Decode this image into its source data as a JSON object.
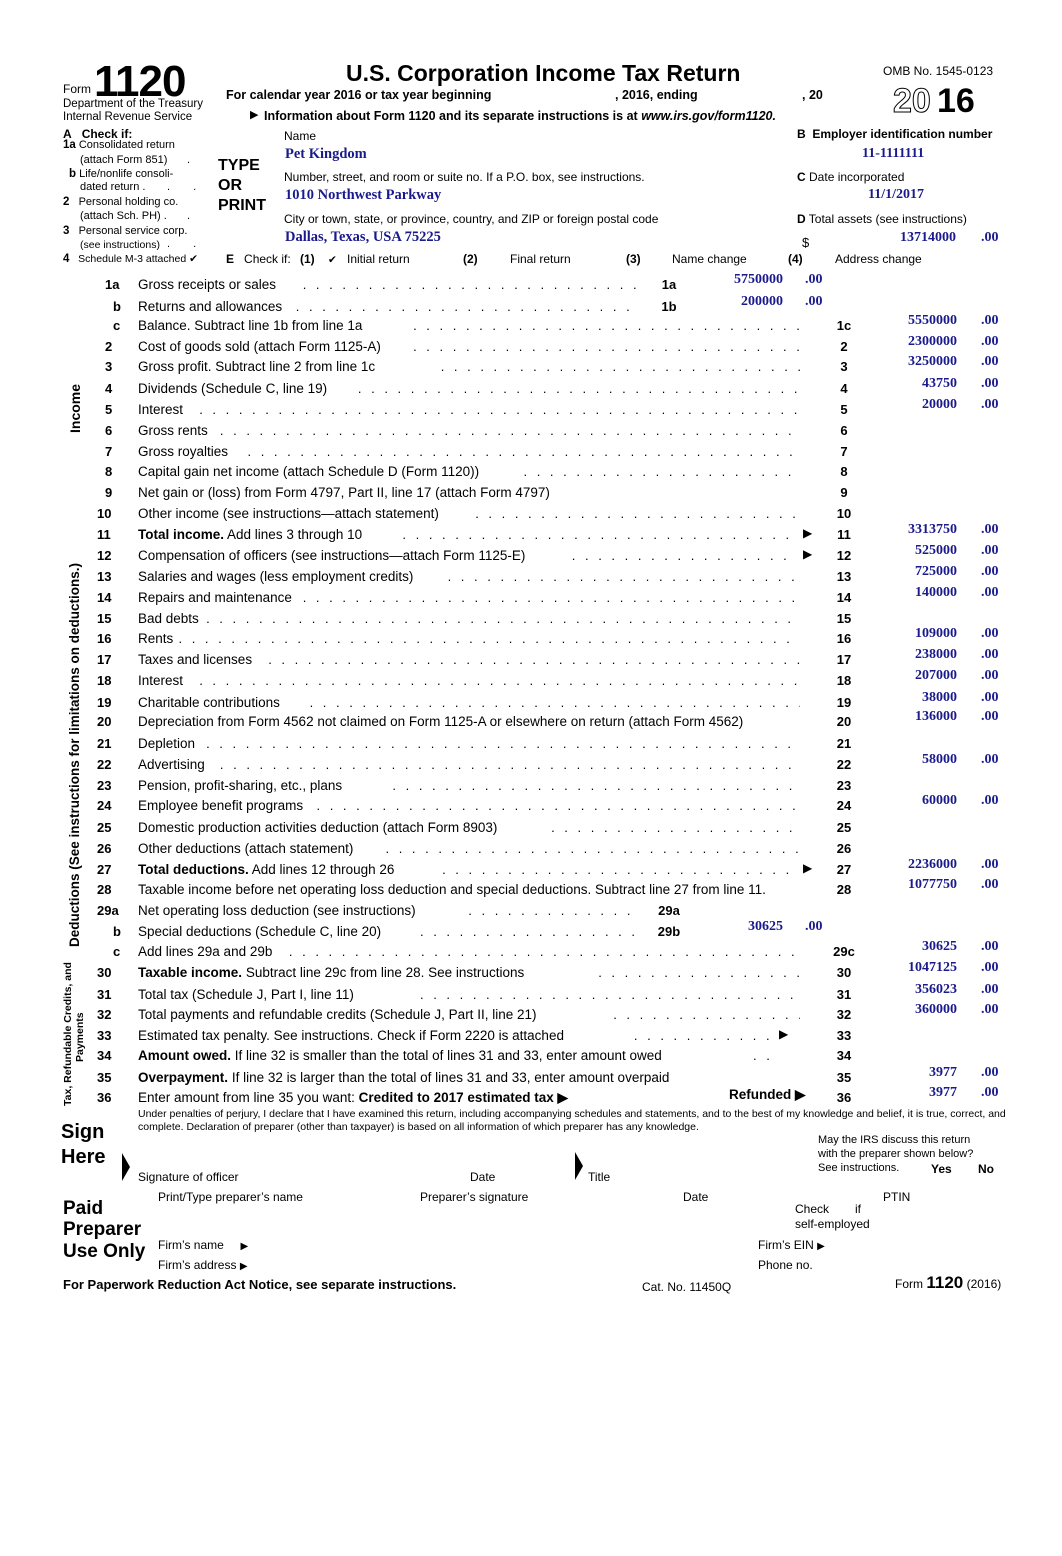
{
  "header": {
    "form_word": "Form",
    "form_number": "1120",
    "department": "Department of the Treasury",
    "agency": "Internal Revenue Service",
    "title": "U.S. Corporation Income Tax Return",
    "calendar_year_text": "For calendar year 2016 or tax year beginning",
    "calendar_year_mid": ", 2016, ending",
    "calendar_year_end": ", 20",
    "info_text": "Information about Form 1120 and its separate instructions is at",
    "info_url": "www.irs.gov/form1120.",
    "omb": "OMB No. 1545-0123",
    "year_outline": "20",
    "year_solid": "16"
  },
  "check_a": {
    "title_letter": "A",
    "title": "Check if:",
    "items": [
      {
        "num": "1a",
        "line1": "Consolidated return",
        "line2": "(attach Form 851)",
        "dots": ".",
        "check": ""
      },
      {
        "num": "b",
        "line1": "Life/nonlife consoli-",
        "line2": "dated return .",
        "dots": ". .",
        "check": ""
      },
      {
        "num": "2",
        "line1": "Personal holding co.",
        "line2": "(attach Sch. PH) .",
        "dots": ".",
        "check": ""
      },
      {
        "num": "3",
        "line1": "Personal service corp.",
        "line2": "(see instructions)",
        "dots": ". .",
        "check": ""
      },
      {
        "num": "4",
        "line1": "Schedule M-3 attached",
        "line2": "",
        "dots": "",
        "check": "✔"
      }
    ]
  },
  "type_or_print": "TYPE\nOR\nPRINT",
  "entity": {
    "name_label": "Name",
    "name": "Pet Kingdom",
    "street_label": "Number, street, and room or suite no. If a P.O. box, see instructions.",
    "street": "1010 Northwest Parkway",
    "city_label": "City or town, state, or province, country, and ZIP or foreign postal code",
    "city": "Dallas, Texas, USA 75225",
    "ein_letter": "B",
    "ein_label": "Employer identification number",
    "ein": "11-1111111",
    "inc_letter": "C",
    "inc_label": "Date incorporated",
    "inc_date": "11/1/2017",
    "assets_letter": "D",
    "assets_label": "Total assets (see instructions)",
    "assets_currency": "$",
    "assets": "13714000",
    "assets_cents": ".00"
  },
  "check_e": {
    "letter": "E",
    "label": "Check if:",
    "options": [
      {
        "num": "(1)",
        "label": "Initial return",
        "check": "✔"
      },
      {
        "num": "(2)",
        "label": "Final return",
        "check": ""
      },
      {
        "num": "(3)",
        "label": "Name change",
        "check": ""
      },
      {
        "num": "(4)",
        "label": "Address change",
        "check": ""
      }
    ]
  },
  "section_labels": {
    "income": "Income",
    "deductions": "Deductions (See instructions for limitations on deductions.)",
    "tax": "Tax, Refundable Credits, and",
    "tax2": "Payments"
  },
  "lines": [
    {
      "num": "1a",
      "text": "Gross receipts or sales",
      "box": "1a",
      "amount": "5750000",
      "cents": ".00",
      "col": "inner"
    },
    {
      "num": "b",
      "text": "Returns and allowances",
      "box": "1b",
      "amount": "200000",
      "cents": ".00",
      "col": "inner"
    },
    {
      "num": "c",
      "text": "Balance.  Subtract line 1b from line 1a",
      "box": "1c",
      "amount": "5550000",
      "cents": ".00"
    },
    {
      "num": "2",
      "text": "Cost of goods sold (attach Form 1125-A)",
      "box": "2",
      "amount": "2300000",
      "cents": ".00"
    },
    {
      "num": "3",
      "text": "Gross profit.  Subtract line 2 from line 1c",
      "box": "3",
      "amount": "3250000",
      "cents": ".00"
    },
    {
      "num": "4",
      "text": "Dividends (Schedule C, line 19)",
      "box": "4",
      "amount": "43750",
      "cents": ".00"
    },
    {
      "num": "5",
      "text": "Interest",
      "box": "5",
      "amount": "20000",
      "cents": ".00"
    },
    {
      "num": "6",
      "text": "Gross rents",
      "box": "6",
      "amount": "",
      "cents": ""
    },
    {
      "num": "7",
      "text": "Gross royalties",
      "box": "7",
      "amount": "",
      "cents": ""
    },
    {
      "num": "8",
      "text": "Capital gain net income (attach Schedule D (Form 1120))",
      "box": "8",
      "amount": "",
      "cents": ""
    },
    {
      "num": "9",
      "text": "Net gain or (loss) from Form 4797, Part II, line 17 (attach Form 4797)",
      "box": "9",
      "amount": "",
      "cents": ""
    },
    {
      "num": "10",
      "text": "Other income (see instructions—attach statement)",
      "box": "10",
      "amount": "",
      "cents": ""
    },
    {
      "num": "11",
      "bold": "Total income.",
      "text": "Add lines 3 through 10",
      "box": "11",
      "amount": "3313750",
      "cents": ".00",
      "arrow": "▶"
    },
    {
      "num": "12",
      "text": "Compensation of officers (see instructions—attach Form 1125-E)",
      "box": "12",
      "amount": "525000",
      "cents": ".00",
      "arrow": "▶"
    },
    {
      "num": "13",
      "text": "Salaries and wages (less employment credits)",
      "box": "13",
      "amount": "725000",
      "cents": ".00"
    },
    {
      "num": "14",
      "text": "Repairs and maintenance",
      "box": "14",
      "amount": "140000",
      "cents": ".00"
    },
    {
      "num": "15",
      "text": "Bad debts",
      "box": "15",
      "amount": "",
      "cents": ""
    },
    {
      "num": "16",
      "text": "Rents",
      "box": "16",
      "amount": "109000",
      "cents": ".00"
    },
    {
      "num": "17",
      "text": "Taxes and licenses",
      "box": "17",
      "amount": "238000",
      "cents": ".00"
    },
    {
      "num": "18",
      "text": "Interest",
      "box": "18",
      "amount": "207000",
      "cents": ".00"
    },
    {
      "num": "19",
      "text": "Charitable contributions",
      "box": "19",
      "amount": "38000",
      "cents": ".00"
    },
    {
      "num": "20",
      "text": "Depreciation from Form 4562 not claimed on Form 1125-A or elsewhere on return (attach Form 4562)",
      "box": "20",
      "amount": "136000",
      "cents": ".00"
    },
    {
      "num": "21",
      "text": "Depletion",
      "box": "21",
      "amount": "",
      "cents": ""
    },
    {
      "num": "22",
      "text": "Advertising",
      "box": "22",
      "amount": "58000",
      "cents": ".00"
    },
    {
      "num": "23",
      "text": "Pension, profit-sharing, etc., plans",
      "box": "23",
      "amount": "",
      "cents": ""
    },
    {
      "num": "24",
      "text": "Employee benefit programs",
      "box": "24",
      "amount": "60000",
      "cents": ".00"
    },
    {
      "num": "25",
      "text": "Domestic production activities deduction (attach Form 8903)",
      "box": "25",
      "amount": "",
      "cents": ""
    },
    {
      "num": "26",
      "text": "Other deductions (attach statement)",
      "box": "26",
      "amount": "",
      "cents": ""
    },
    {
      "num": "27",
      "bold": "Total deductions.",
      "text": "Add lines 12 through 26",
      "box": "27",
      "amount": "2236000",
      "cents": ".00",
      "arrow": "▶"
    },
    {
      "num": "28",
      "text": "Taxable income before net operating loss deduction and special deductions. Subtract line 27 from line 11.",
      "box": "28",
      "amount": "1077750",
      "cents": ".00"
    },
    {
      "num": "29a",
      "text": "Net operating loss deduction (see instructions)",
      "box": "29a",
      "amount": "",
      "cents": "",
      "col": "inner"
    },
    {
      "num": "b",
      "text": "Special deductions (Schedule C, line 20)",
      "box": "29b",
      "amount": "30625",
      "cents": ".00",
      "col": "inner"
    },
    {
      "num": "c",
      "text": "Add lines 29a and 29b",
      "box": "29c",
      "amount": "30625",
      "cents": ".00"
    },
    {
      "num": "30",
      "bold": "Taxable income.",
      "text": "Subtract line 29c from line 28. See instructions",
      "box": "30",
      "amount": "1047125",
      "cents": ".00"
    },
    {
      "num": "31",
      "text": "Total tax  (Schedule J, Part I, line 11)",
      "box": "31",
      "amount": "356023",
      "cents": ".00"
    },
    {
      "num": "32",
      "text": "Total payments and refundable credits (Schedule J, Part II, line 21)",
      "box": "32",
      "amount": "360000",
      "cents": ".00"
    },
    {
      "num": "33",
      "text": "Estimated tax penalty. See instructions. Check if Form 2220 is attached",
      "box": "33",
      "amount": "",
      "cents": "",
      "arrow": "▶"
    },
    {
      "num": "34",
      "bold": "Amount owed.",
      "text": "If line 32 is smaller than the total of lines 31 and 33, enter amount owed",
      "box": "34",
      "amount": "",
      "cents": ""
    },
    {
      "num": "35",
      "bold": "Overpayment.",
      "text": "If line 32 is larger than the total of lines 31 and 33, enter amount overpaid",
      "box": "35",
      "amount": "3977",
      "cents": ".00"
    },
    {
      "num": "36",
      "text": "Enter amount from line 35 you want:",
      "bold_after": "Credited to 2017 estimated tax ▶",
      "refunded": "Refunded ▶",
      "box": "36",
      "amount": "3977",
      "cents": ".00"
    }
  ],
  "sign": {
    "perjury": "Under penalties of perjury, I declare that I have examined this return, including accompanying schedules and statements, and to the best of my knowledge and belief, it is true, correct, and complete. Declaration of preparer (other than taxpayer) is based on all information of which preparer has any knowledge.",
    "sign_title": "Sign",
    "here_title": "Here",
    "signature_label": "Signature of officer",
    "date_label": "Date",
    "title_label": "Title",
    "discuss_line1": "May the IRS discuss this return",
    "discuss_line2": "with the preparer shown below?",
    "discuss_line3": "See instructions.",
    "yes": "Yes",
    "no": "No"
  },
  "preparer": {
    "title1": "Paid",
    "title2": "Preparer",
    "title3": "Use Only",
    "name_label": "Print/Type preparer’s name",
    "signature_label": "Preparer’s signature",
    "date_label": "Date",
    "check_label1": "Check",
    "check_label_if": "if",
    "check_label2": "self-employed",
    "ptin_label": "PTIN",
    "firm_name_label": "Firm’s name",
    "firm_address_label": "Firm’s address",
    "firm_ein_label": "Firm’s EIN",
    "phone_label": "Phone no.",
    "arrow": "▶"
  },
  "footer": {
    "paperwork": "For Paperwork Reduction Act Notice, see separate instructions.",
    "cat_no": "Cat. No. 11450Q",
    "form_word": "Form",
    "form_number": "1120",
    "form_year": "(2016)"
  }
}
